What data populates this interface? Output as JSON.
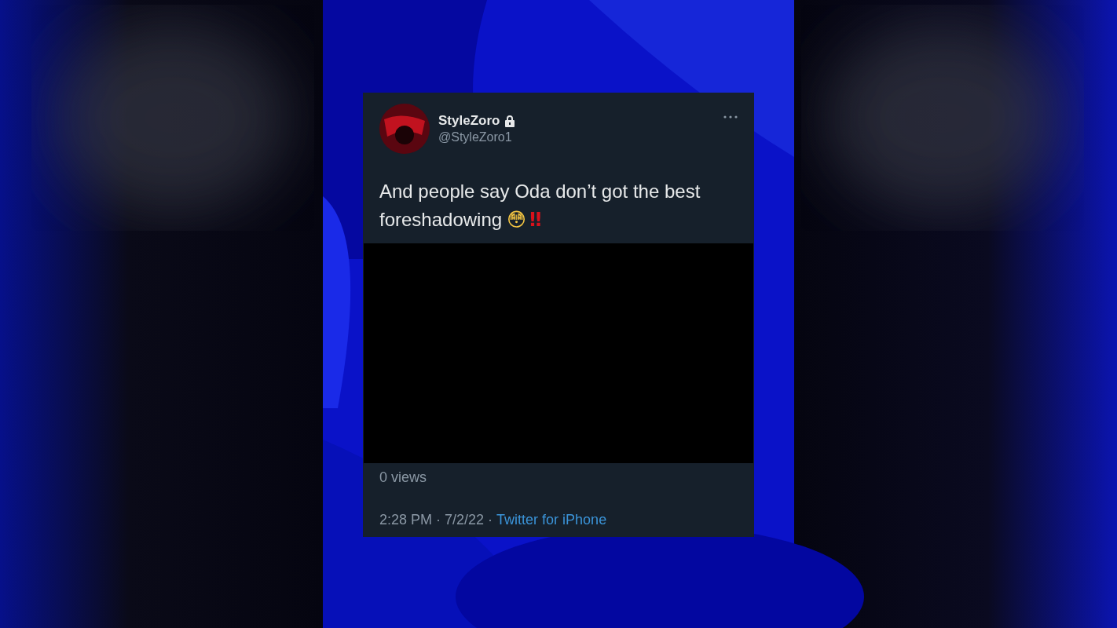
{
  "tweet": {
    "display_name": "StyleZoro",
    "protected": true,
    "handle": "@StyleZoro1",
    "text": "And people say Oda don’t got the best foreshadowing",
    "emoji": "😳",
    "exclamation": "‼",
    "views": "0 views",
    "timestamp": "2:28 PM · 7/2/22 ·",
    "source": "Twitter for iPhone"
  }
}
